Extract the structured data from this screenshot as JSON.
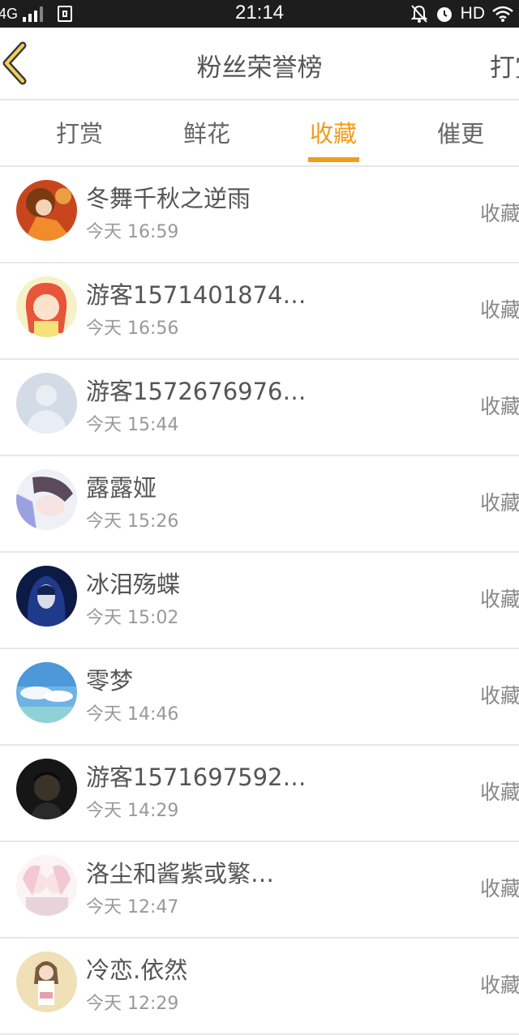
{
  "status_bar": {
    "network": "4G",
    "time": "21:14",
    "hd": "HD"
  },
  "header": {
    "title": "粉丝荣誉榜",
    "right_label": "打赏"
  },
  "tabs": [
    {
      "label": "打赏",
      "active": false
    },
    {
      "label": "鲜花",
      "active": false
    },
    {
      "label": "收藏",
      "active": true
    },
    {
      "label": "催更",
      "active": false
    }
  ],
  "accent_color": "#f39b1a",
  "fans": [
    {
      "name": "冬舞千秋之逆雨",
      "time": "今天 16:59",
      "action": "收藏"
    },
    {
      "name": "游客1571401874…",
      "time": "今天 16:56",
      "action": "收藏"
    },
    {
      "name": "游客1572676976…",
      "time": "今天 15:44",
      "action": "收藏"
    },
    {
      "name": "露露娅",
      "time": "今天 15:26",
      "action": "收藏"
    },
    {
      "name": "冰泪殇蝶",
      "time": "今天 15:02",
      "action": "收藏"
    },
    {
      "name": "零梦",
      "time": "今天 14:46",
      "action": "收藏"
    },
    {
      "name": "游客1571697592…",
      "time": "今天 14:29",
      "action": "收藏"
    },
    {
      "name": "洛尘和酱紫或繁…",
      "time": "今天 12:47",
      "action": "收藏"
    },
    {
      "name": "冷恋.依然",
      "time": "今天 12:29",
      "action": "收藏"
    }
  ]
}
